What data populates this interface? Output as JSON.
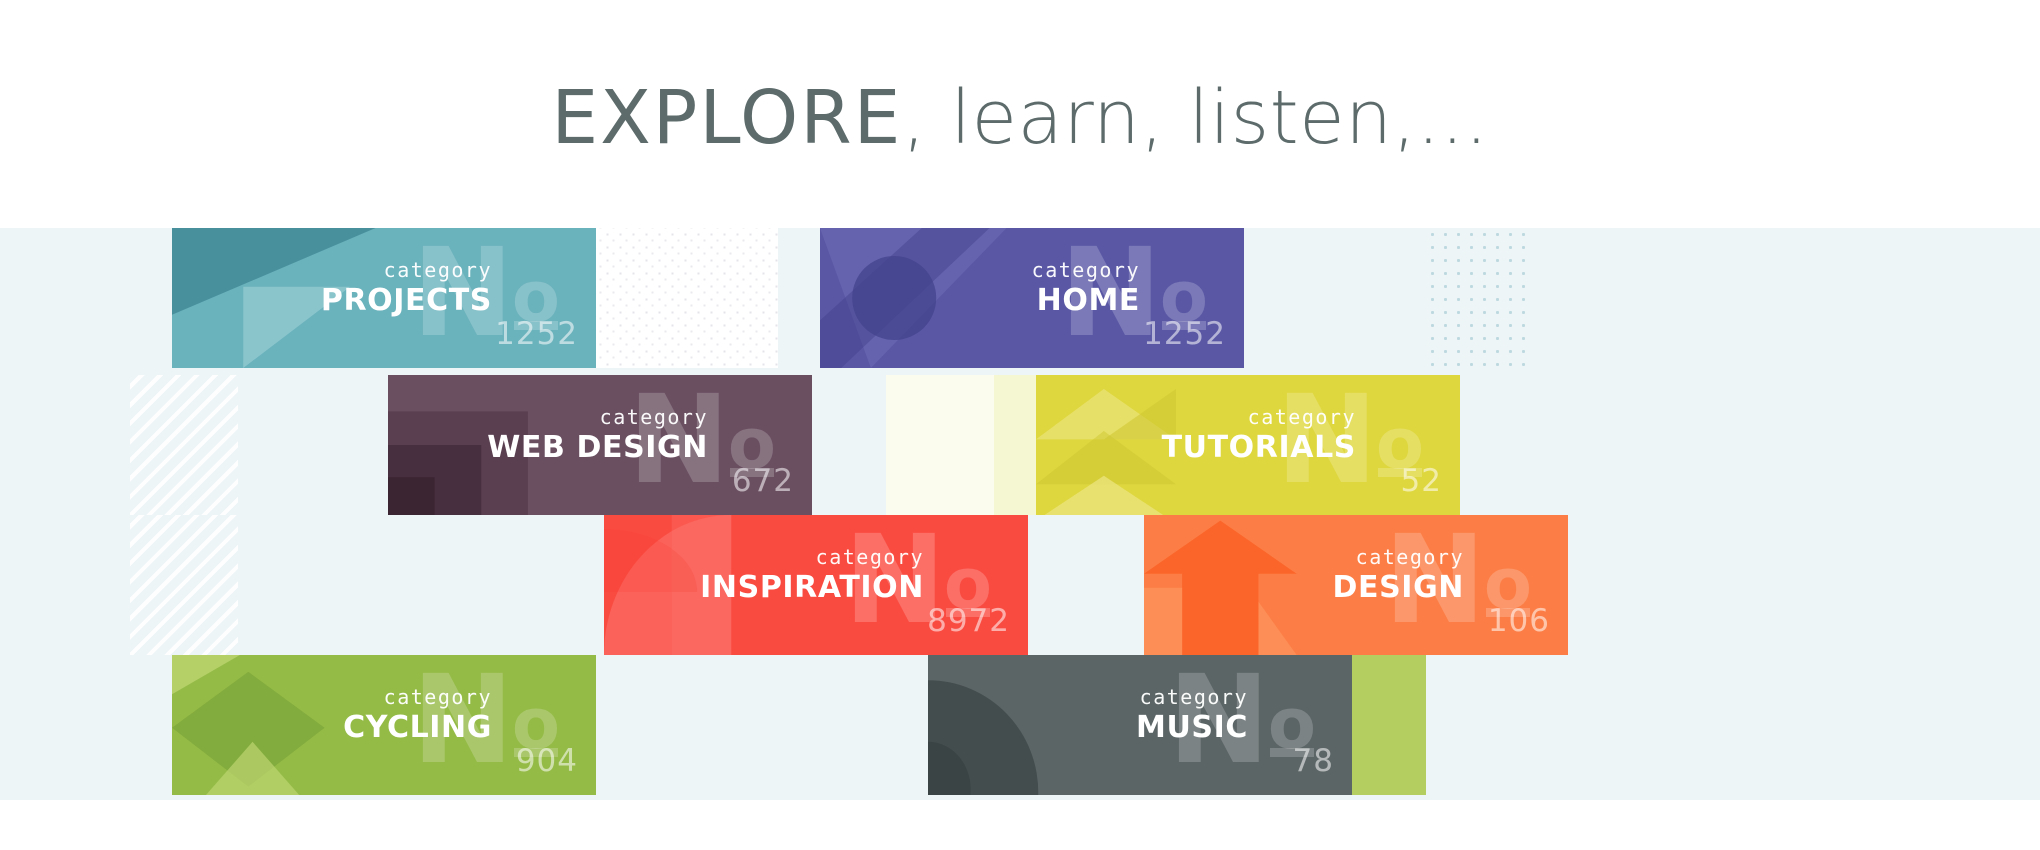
{
  "heading": {
    "strong": "EXPLORE",
    "rest": ", learn, listen,...",
    "full": "EXPLORE, learn, listen,...",
    "color": "#5d6b6b"
  },
  "category_label": "category",
  "numero_symbol": "N",
  "numero_superscript": "o",
  "tiles": [
    {
      "id": "projects",
      "label": "category",
      "name": "PROJECTS",
      "count": "1252",
      "color": "#6ab2bc",
      "shade_dark": "#47909c",
      "shade_light": "#8fc8cf",
      "decoration": "triangles",
      "col": 0,
      "row": 0,
      "span": 3
    },
    {
      "id": "home",
      "label": "category",
      "name": "HOME",
      "count": "1252",
      "color": "#5a58a5",
      "shade_dark": "#43418c",
      "shade_light": "#6f6db6",
      "decoration": "circle",
      "col": 6,
      "row": 0,
      "span": 3
    },
    {
      "id": "web-design",
      "label": "category",
      "name": "WEB DESIGN",
      "count": "672",
      "color": "#6a4f61",
      "shade_dark": "#3b2331",
      "shade_light": "#7d6274",
      "decoration": "nested-squares",
      "col": 2,
      "row": 1,
      "span": 3
    },
    {
      "id": "tutorials",
      "label": "category",
      "name": "TUTORIALS",
      "count": "52",
      "color": "#dfd73e",
      "shade_dark": "#cdc62f",
      "shade_light": "#ece685",
      "decoration": "arrows",
      "col": 8,
      "row": 1,
      "span": 3
    },
    {
      "id": "inspiration",
      "label": "category",
      "name": "INSPIRATION",
      "count": "8972",
      "color": "#fa4b41",
      "shade_dark": "#f8372c",
      "shade_light": "#fc766d",
      "decoration": "circle-quarters",
      "col": 4,
      "row": 2,
      "span": 3
    },
    {
      "id": "design",
      "label": "category",
      "name": "DESIGN",
      "count": "106",
      "color": "#fc7e46",
      "shade_dark": "#fb5c1f",
      "shade_light": "#fd9a63",
      "decoration": "up-arrow",
      "col": 9,
      "row": 2,
      "span": 3
    },
    {
      "id": "cycling",
      "label": "category",
      "name": "CYCLING",
      "count": "904",
      "color": "#95bb47",
      "shade_dark": "#7ba539",
      "shade_light": "#bcd66f",
      "decoration": "diamond",
      "col": 0,
      "row": 3,
      "span": 3
    },
    {
      "id": "music",
      "label": "category",
      "name": "MUSIC",
      "count": "78",
      "color": "#5c6566",
      "shade_dark": "#3b4344",
      "shade_light": "#6e7778",
      "decoration": "vinyl",
      "col": 7,
      "row": 3,
      "span": 3
    }
  ],
  "background_blocks": [
    {
      "id": "bg-pale-1",
      "style": "solid-pale",
      "col": 0,
      "row": 0,
      "span": 1
    },
    {
      "id": "bg-dots-1",
      "style": "pat-diag-dots",
      "col": 4,
      "row": 0,
      "span": 2
    },
    {
      "id": "bg-pale-2",
      "style": "solid-pale",
      "col": 11,
      "row": 0,
      "span": 1
    },
    {
      "id": "bg-grid-dots",
      "style": "pat-grid-dots",
      "col": 12,
      "row": 0,
      "span": 1
    },
    {
      "id": "bg-stripe-1",
      "style": "pat-diag-stripe",
      "col": 0,
      "row": 1,
      "span": 1
    },
    {
      "id": "bg-mint",
      "style": "pat-mint-diag",
      "col": 5,
      "row": 1,
      "span": 1
    },
    {
      "id": "bg-cream-1",
      "style": "solid-cream",
      "col": 7,
      "row": 1,
      "span": 1
    },
    {
      "id": "bg-paleyell",
      "style": "solid-paleyellow",
      "col": 8,
      "row": 1,
      "span": 1
    },
    {
      "id": "bg-stripe-2",
      "style": "pat-diag-stripe",
      "col": 0,
      "row": 2,
      "span": 1
    },
    {
      "id": "bg-cream-2",
      "style": "solid-cream2",
      "col": 1,
      "row": 3,
      "span": 2
    },
    {
      "id": "bg-green-1",
      "style": "solid-palegreen",
      "col": 11,
      "row": 3,
      "span": 1
    }
  ]
}
